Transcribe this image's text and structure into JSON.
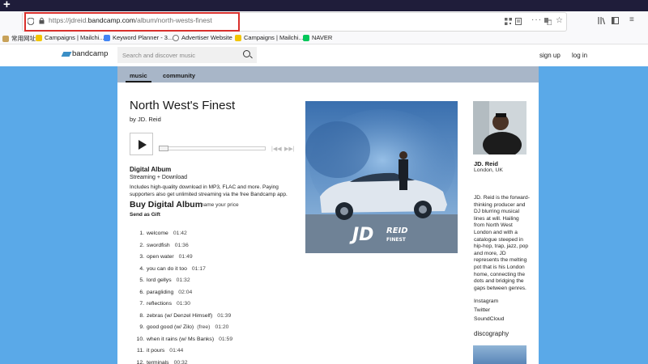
{
  "browser": {
    "url_prefix": "https://jdreid.",
    "url_domain": "bandcamp.com",
    "url_path": "/album/north-wests-finest",
    "bookmarks": [
      {
        "label": "常用网址",
        "color": "#c8a25a"
      },
      {
        "label": "Campaigns | Mailchi...",
        "color": "#f2c400"
      },
      {
        "label": "Keyword Planner - 3...",
        "color": "#4285f4"
      },
      {
        "label": "Advertiser Website",
        "color": "#777777"
      },
      {
        "label": "Campaigns | Mailchi...",
        "color": "#f2c400"
      },
      {
        "label": "NAVER",
        "color": "#03c75a"
      }
    ]
  },
  "site": {
    "logo": "bandcamp",
    "search_placeholder": "Search and discover music",
    "signup": "sign up",
    "login": "log in",
    "tabs": [
      "music",
      "community"
    ]
  },
  "album": {
    "title": "North West's Finest",
    "by": "by JD. Reid",
    "format_title": "Digital Album",
    "format_sub": "Streaming + Download",
    "format_desc": "Includes high-quality download in MP3, FLAC and more. Paying supporters also get unlimited streaming via the free Bandcamp app.",
    "buy": "Buy Digital Album",
    "name_price": "name your price",
    "gift": "Send as Gift",
    "art_text_1": "JD",
    "art_text_2": "REID",
    "art_text_3": "FINEST",
    "tracks": [
      {
        "n": "1.",
        "title": "welcome",
        "dur": "01:42",
        "extra": ""
      },
      {
        "n": "2.",
        "title": "swordfish",
        "dur": "01:36",
        "extra": ""
      },
      {
        "n": "3.",
        "title": "open water",
        "dur": "01:49",
        "extra": ""
      },
      {
        "n": "4.",
        "title": "you can do it too",
        "dur": "01:17",
        "extra": ""
      },
      {
        "n": "5.",
        "title": "lord gellys",
        "dur": "01:32",
        "extra": ""
      },
      {
        "n": "6.",
        "title": "paragliding",
        "dur": "02:04",
        "extra": ""
      },
      {
        "n": "7.",
        "title": "reflections",
        "dur": "01:30",
        "extra": ""
      },
      {
        "n": "8.",
        "title": "zebras (w/ Denzel Himself)",
        "dur": "01:39",
        "extra": ""
      },
      {
        "n": "9.",
        "title": "good good (w/ Zilo)",
        "dur": "01:20",
        "extra": "(free)"
      },
      {
        "n": "10.",
        "title": "when it rains (w/ Ms Banks)",
        "dur": "01:59",
        "extra": ""
      },
      {
        "n": "11.",
        "title": "it pours",
        "dur": "01:44",
        "extra": ""
      },
      {
        "n": "12.",
        "title": "terminals",
        "dur": "00:32",
        "extra": ""
      }
    ]
  },
  "artist": {
    "name": "JD. Reid",
    "location": "London, UK",
    "bio": "JD. Reid is the forward-thinking producer and DJ blurring musical lines at will. Hailing from North West London and with a catalogue steeped in hip-hop, trap, jazz, pop and more, JD represents the melting pot that is his London home, connecting the dots and bridging the gaps between genres.",
    "links": [
      "Instagram",
      "Twitter",
      "SoundCloud"
    ],
    "discography": "discography"
  }
}
